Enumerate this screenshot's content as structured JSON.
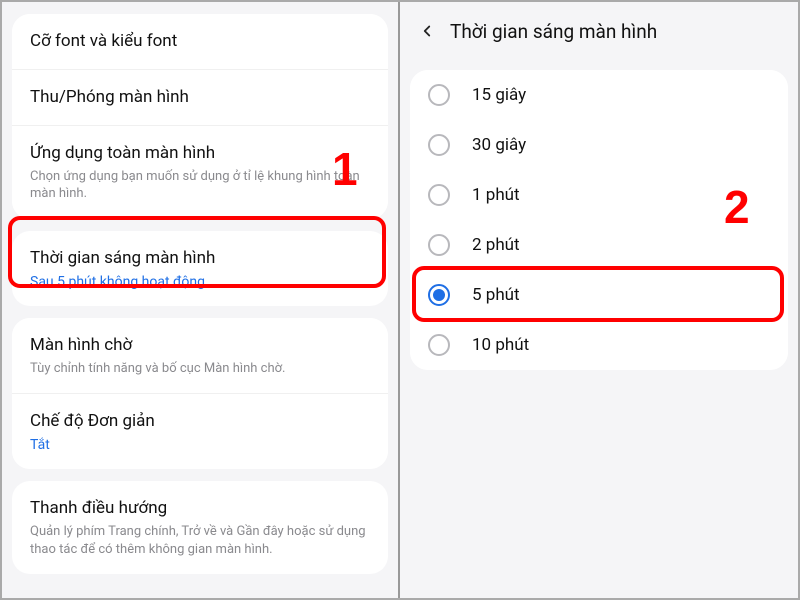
{
  "left": {
    "group1": [
      {
        "title": "Cỡ font và kiểu font",
        "sub": null,
        "blue": null
      },
      {
        "title": "Thu/Phóng màn hình",
        "sub": null,
        "blue": null
      },
      {
        "title": "Ứng dụng toàn màn hình",
        "sub": "Chọn ứng dụng bạn muốn sử dụng ở tỉ lệ khung hình toàn màn hình.",
        "blue": null
      }
    ],
    "group2": [
      {
        "title": "Thời gian sáng màn hình",
        "sub": null,
        "blue": "Sau 5 phút không hoạt động"
      }
    ],
    "group3": [
      {
        "title": "Màn hình chờ",
        "sub": "Tùy chỉnh tính năng và bố cục Màn hình chờ.",
        "blue": null
      },
      {
        "title": "Chế độ Đơn giản",
        "sub": null,
        "blue": "Tắt"
      }
    ],
    "group4": [
      {
        "title": "Thanh điều hướng",
        "sub": "Quản lý phím Trang chính, Trở về và Gần đây hoặc sử dụng thao tác để có thêm không gian màn hình.",
        "blue": null
      }
    ]
  },
  "right": {
    "header": "Thời gian sáng màn hình",
    "options": [
      {
        "label": "15 giây",
        "selected": false
      },
      {
        "label": "30 giây",
        "selected": false
      },
      {
        "label": "1 phút",
        "selected": false
      },
      {
        "label": "2 phút",
        "selected": false
      },
      {
        "label": "5 phút",
        "selected": true
      },
      {
        "label": "10 phút",
        "selected": false
      }
    ]
  },
  "annotations": {
    "one": "1",
    "two": "2"
  }
}
